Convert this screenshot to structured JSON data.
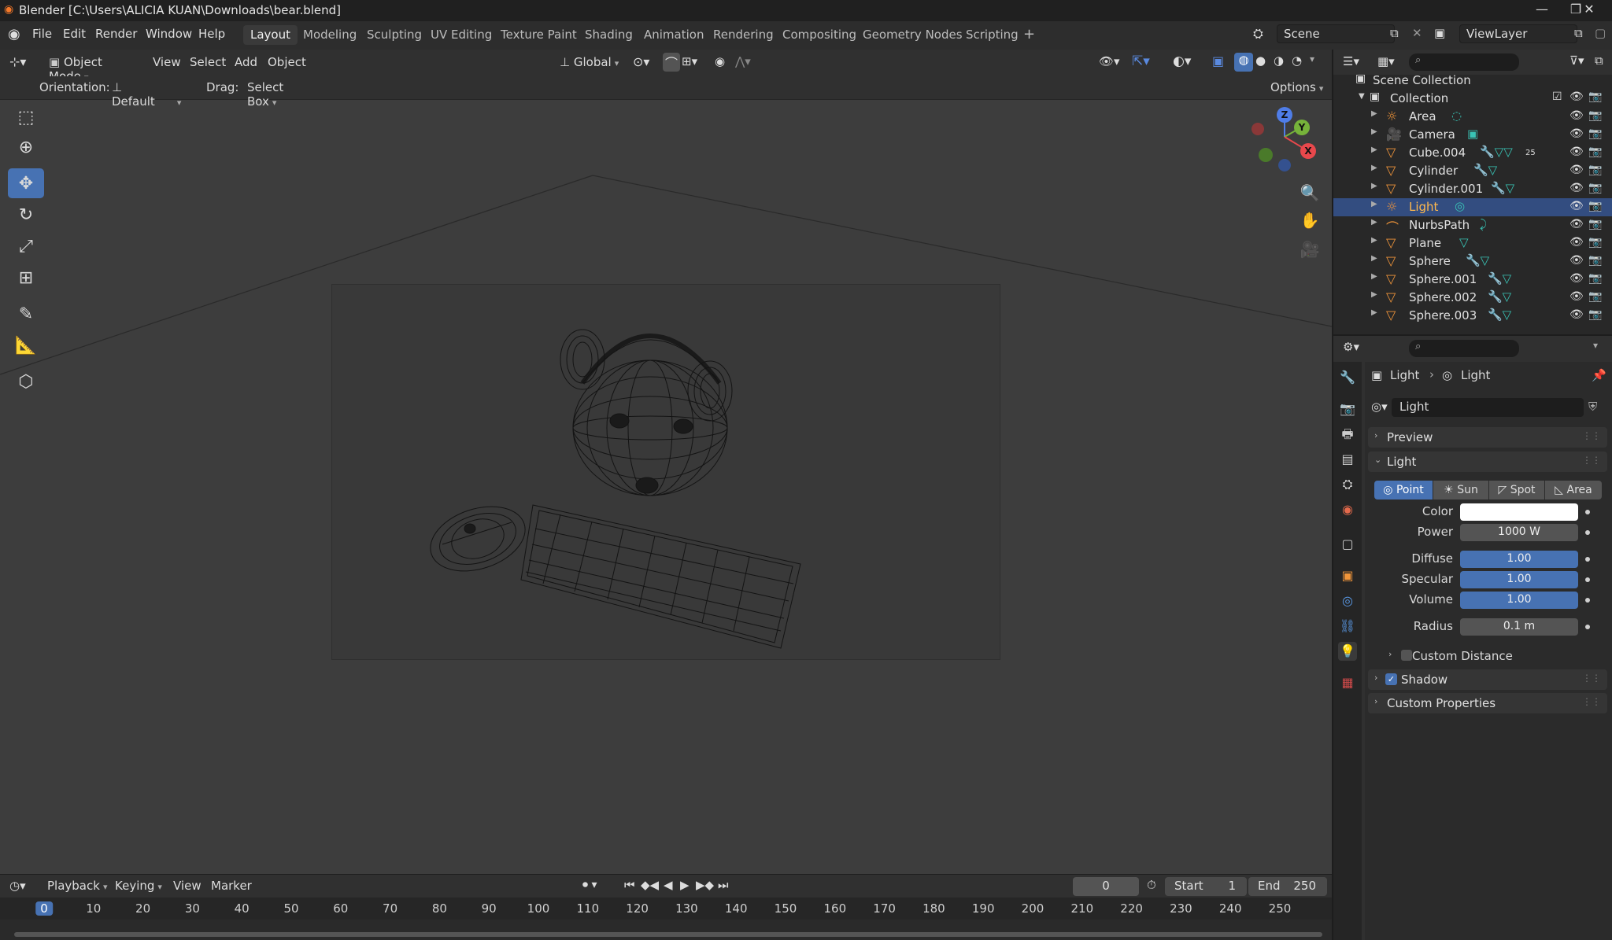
{
  "window": {
    "title": "Blender [C:\\Users\\ALICIA KUAN\\Downloads\\bear.blend]",
    "minimize": "—",
    "restore": "❐",
    "close": "✕"
  },
  "menu": [
    "File",
    "Edit",
    "Render",
    "Window",
    "Help"
  ],
  "workspaces": [
    "Layout",
    "Modeling",
    "Sculpting",
    "UV Editing",
    "Texture Paint",
    "Shading",
    "Animation",
    "Rendering",
    "Compositing",
    "Geometry Nodes",
    "Scripting"
  ],
  "active_workspace": "Layout",
  "scene": {
    "name": "Scene",
    "view_layer": "ViewLayer"
  },
  "viewport": {
    "mode": "Object Mode",
    "menus": [
      "View",
      "Select",
      "Add",
      "Object"
    ],
    "transform_orientation": "Global",
    "tool_options": {
      "orientation_label": "Orientation:",
      "orientation_value": "Default",
      "drag_label": "Drag:",
      "drag_value": "Select Box",
      "options_label": "Options"
    },
    "gizmo": {
      "z": "Z",
      "y": "Y",
      "x": "X"
    }
  },
  "outliner": {
    "root": "Scene Collection",
    "collection": "Collection",
    "objects": [
      {
        "name": "Area",
        "icon": "light-icon",
        "selected": false
      },
      {
        "name": "Camera",
        "icon": "camera-icon",
        "selected": false
      },
      {
        "name": "Cube.004",
        "icon": "mesh-icon",
        "selected": false,
        "badge": "25"
      },
      {
        "name": "Cylinder",
        "icon": "mesh-icon",
        "selected": false
      },
      {
        "name": "Cylinder.001",
        "icon": "mesh-icon",
        "selected": false
      },
      {
        "name": "Light",
        "icon": "light-icon",
        "selected": true
      },
      {
        "name": "NurbsPath",
        "icon": "curve-icon",
        "selected": false
      },
      {
        "name": "Plane",
        "icon": "mesh-icon",
        "selected": false
      },
      {
        "name": "Sphere",
        "icon": "mesh-icon",
        "selected": false
      },
      {
        "name": "Sphere.001",
        "icon": "mesh-icon",
        "selected": false
      },
      {
        "name": "Sphere.002",
        "icon": "mesh-icon",
        "selected": false
      },
      {
        "name": "Sphere.003",
        "icon": "mesh-icon",
        "selected": false
      }
    ]
  },
  "properties": {
    "breadcrumb": [
      "Light",
      "Light"
    ],
    "datablock": "Light",
    "panels": {
      "preview": "Preview",
      "light": "Light",
      "custom_distance": "Custom Distance",
      "shadow": "Shadow",
      "custom_properties": "Custom Properties"
    },
    "light_types": [
      "Point",
      "Sun",
      "Spot",
      "Area"
    ],
    "active_type": "Point",
    "fields": {
      "color_label": "Color",
      "color_value": "#ffffff",
      "power_label": "Power",
      "power_value": "1000 W",
      "diffuse_label": "Diffuse",
      "diffuse_value": "1.00",
      "specular_label": "Specular",
      "specular_value": "1.00",
      "volume_label": "Volume",
      "volume_value": "1.00",
      "radius_label": "Radius",
      "radius_value": "0.1 m"
    },
    "custom_distance_checked": false,
    "shadow_checked": true
  },
  "timeline": {
    "menus": [
      "Playback",
      "Keying",
      "View",
      "Marker"
    ],
    "current_frame": "0",
    "start_label": "Start",
    "start_value": "1",
    "end_label": "End",
    "end_value": "250",
    "ticks": [
      "0",
      "10",
      "20",
      "30",
      "40",
      "50",
      "60",
      "70",
      "80",
      "90",
      "100",
      "110",
      "120",
      "130",
      "140",
      "150",
      "160",
      "170",
      "180",
      "190",
      "200",
      "210",
      "220",
      "230",
      "240",
      "250"
    ]
  },
  "colors": {
    "accent": "#4772b3",
    "selection": "#334d80",
    "mesh_icon": "#f0953a",
    "modifier_icon": "#39c3b5"
  }
}
